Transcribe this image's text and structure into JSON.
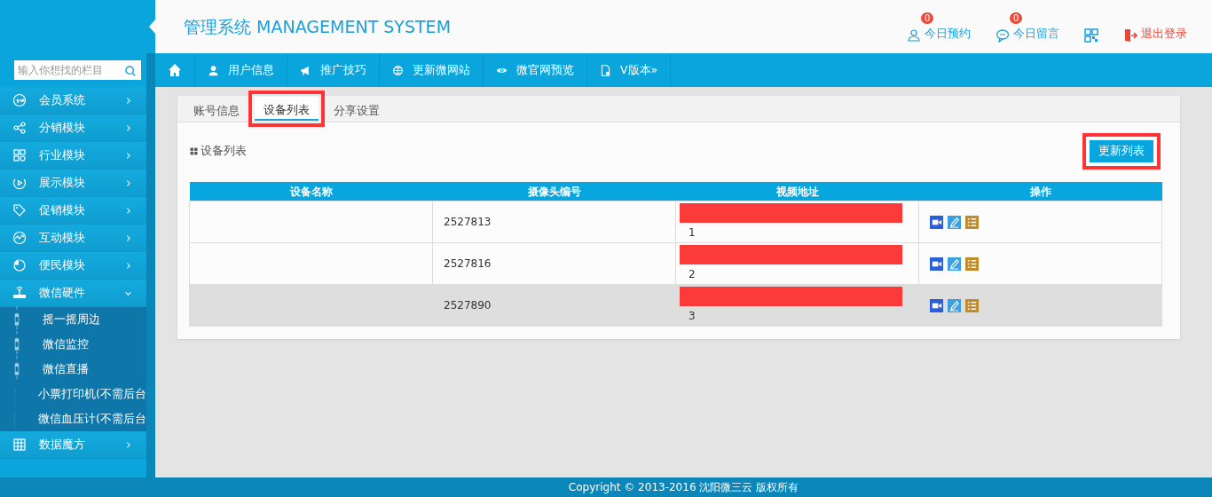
{
  "header": {
    "title": "管理系统 MANAGEMENT SYSTEM",
    "actions": [
      {
        "kind": "person",
        "label": "今日预约",
        "badge": "0"
      },
      {
        "kind": "chat",
        "label": "今日留言",
        "badge": "0"
      },
      {
        "kind": "qr"
      },
      {
        "kind": "logout",
        "label": "退出登录"
      }
    ]
  },
  "search": {
    "placeholder": "输入你想找的栏目"
  },
  "nav": [
    {
      "kind": "home"
    },
    {
      "kind": "user",
      "label": "用户信息"
    },
    {
      "kind": "megaphone",
      "label": "推广技巧"
    },
    {
      "kind": "globe",
      "label": "更新微网站"
    },
    {
      "kind": "eye",
      "label": "微官网预览"
    },
    {
      "kind": "doc",
      "label": "V版本»"
    }
  ],
  "sidebar": {
    "items": [
      {
        "kind": "vip",
        "label": "会员系统",
        "expanded": false
      },
      {
        "kind": "share",
        "label": "分销模块",
        "expanded": false
      },
      {
        "kind": "grid",
        "label": "行业模块",
        "expanded": false
      },
      {
        "kind": "play",
        "label": "展示模块",
        "expanded": false
      },
      {
        "kind": "tag",
        "label": "促销模块",
        "expanded": false
      },
      {
        "kind": "pulse",
        "label": "互动模块",
        "expanded": false
      },
      {
        "kind": "pie",
        "label": "便民模块",
        "expanded": false
      },
      {
        "kind": "router",
        "label": "微信硬件",
        "expanded": true,
        "children": [
          {
            "label": "摇一摇周边"
          },
          {
            "label": "微信监控"
          },
          {
            "label": "微信直播"
          },
          {
            "label": "小票打印机(不需后台"
          },
          {
            "label": "微信血压计(不需后台"
          }
        ]
      },
      {
        "kind": "table",
        "label": "数据魔方",
        "expanded": false
      }
    ]
  },
  "tabs": [
    {
      "label": "账号信息",
      "selected": false,
      "highlighted": false
    },
    {
      "label": "设备列表",
      "selected": true,
      "highlighted": true
    },
    {
      "label": "分享设置",
      "selected": false,
      "highlighted": false
    }
  ],
  "panel": {
    "title": "设备列表",
    "button": {
      "label": "更新列表",
      "highlighted": true
    }
  },
  "table": {
    "columns": [
      "设备名称",
      "摄像头编号",
      "视频地址",
      "操作"
    ],
    "rows": [
      {
        "camera_id": "2527813",
        "video_tail": "1",
        "redacted": true,
        "selected": false
      },
      {
        "camera_id": "2527816",
        "video_tail": "2",
        "redacted": true,
        "selected": false
      },
      {
        "camera_id": "2527890",
        "video_tail": "3",
        "redacted": true,
        "selected": true
      }
    ]
  },
  "footer": {
    "text": "Copyright © 2013-2016 沈阳微三云 版权所有"
  }
}
